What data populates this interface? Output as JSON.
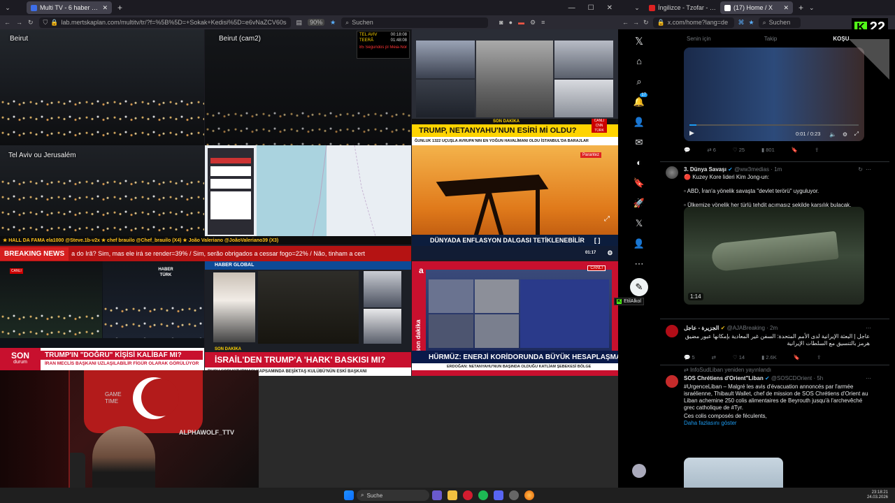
{
  "left_browser": {
    "tab_title": "Multi TV - 6 haber kanalını aynı anda",
    "url": "lab.mertskaplan.com/multitv/tr/?f=%5B%5D=+Sokak+Kedisi%5D=e6vNaZCV60s8tcn%5D=+CNN+Türk%5D=6N8_r2uwLEc",
    "zoom": "90%",
    "search_placeholder": "Suchen"
  },
  "tiles": {
    "beirut": "Beirut",
    "beirut_cam2": "Beirut (cam2)",
    "telaviv": "Tel Aviv ou Jerusalém",
    "timers": {
      "row1_label": "TEL AVIV",
      "row1_time": "00:18:08",
      "row2_label": "TEERÃ",
      "row2_time": "01:48:08",
      "red_text": "85 Segundos pl Meia-Noite"
    },
    "cnn_ticker": "SON DAKİKA",
    "cnn_headline": "TRUMP, NETANYAHU'NUN ESİRİ Mİ OLDU?",
    "cnn_crawl": "ĞUNLUK 1322 UÇUŞLA AVRUPA'NIN EN YOĞUN HAVALİMANI OLDU   İSTANBUL'DA BARAJLAR",
    "cnn_logo": "CNN TÜRK",
    "cnn_live": "CANLI",
    "oil_headline": "DÜNYADA ENFLASYON DALGASI TETİKLENEBİLİR",
    "oil_time": "01:17",
    "oil_logo": "Parantez",
    "ticker_bar": "★ HALL DA FAMA   ela1000 @Steve.1b-v2x   ★ chef brauilo @Chef_brauilo (X4)   ★ João Valeriano @JoãoValeriano39 (X3)",
    "breaking_label": "BREAKING NEWS",
    "breaking_text": "a do Irã? Sim, mas ele irá se render=39% / Sim, serão obrigados a cessar fogo=22% / Não, tinham a cert",
    "haberturk_son": "SON",
    "haberturk_durum": "durum",
    "haberturk_headline": "TRUMP'IN \"DOĞRU\" KİŞİSİ KALİBAF MI?",
    "haberturk_sub": "İRAN MECLİS BAŞKANI UZLAŞILABİLİR FİGÜR OLARAK GÖRÜLÜYOR",
    "haberturk_logo": "HABER TÜRK",
    "haberturk_canli": "CANLI",
    "haberglobal_logo": "HABER GLOBAL",
    "haberglobal_son": "SON DAKİKA",
    "haberglobal_headline": "İSRAİL'DEN TRUMP'A 'HARK' BASKISI MI?",
    "haberglobal_crawl": "RUCU SORUŞTURMASI KAPSAMINDA BEŞİKTAŞ KULÜBÜ'NÜN ESKİ BAŞKANI",
    "a_son": "son dakika",
    "a_headline": "HÜRMÜZ: ENERJİ KORİDORUNDA BÜYÜK HESAPLAŞMA",
    "a_crawl": "ERDOĞAN: NETANYAHU'NUN BAŞINDA OLDUĞU KATLİAM ŞEBEKESİ BÖLGE",
    "a_canli": "CANLI"
  },
  "streamer": {
    "overlay": "ALPHAWOLF_TTV",
    "sign": "GAME TIME"
  },
  "right_browser": {
    "tab1": "İngilizce - Tzofar - Kırmızı Alarm",
    "tab2": "(17) Home / X",
    "url": "x.com/home?lang=de",
    "search_placeholder": "Suchen"
  },
  "overlay_badge": {
    "letter": "K",
    "number": "22"
  },
  "x": {
    "tab_foryou": "Senin için",
    "tab_following": "Takip",
    "tab_right": "KOŞU",
    "notif_count": "17",
    "video1_time": "0:01 / 0:23",
    "tweet1_stats": {
      "reply": "",
      "retweet": "6",
      "like": "25",
      "views": "801"
    },
    "tweet2": {
      "name": "3. Dünya Savaşı",
      "handle": "@ww3medias · 1m",
      "line1": "Kuzey Kore lideri Kim Jong-un:",
      "line2": "ABD, İran'a yönelik savaşta \"devlet terörü\" uyguluyor.",
      "line3": "Ülkemize yönelik her türlü tehdit acımasız şekilde karşılık bulacak.",
      "video_time": "1:14"
    },
    "hover_label": "EtilAlkol",
    "tweet3": {
      "name": "الجزيرة - عاجل",
      "handle": "@AJABreaking · 2m",
      "text": "عاجل | البعثة الإيرانية لدى الأمم المتحدة: السفن غير المعادية بإمكانها عبور مضيق هرمز بالتنسيق مع السلطات الإيرانية",
      "replies": "5",
      "retweets": "14",
      "likes": "2.6K",
      "views": ""
    },
    "tweet4": {
      "reposted_by": "InfoSudLiban yeniden yayınlandı",
      "name": "SOS Chrétiens d'Orient\"Liban",
      "handle": "@SOSCDOrient · 5h",
      "text": "#UrgenceLiban – Malgré les avis d'évacuation annoncés par l'armée israélienne, Thibault Wallet, chef de mission de SOS Chrétiens d'Orient au Liban achemine 250 colis alimentaires de Beyrouth jusqu'à l'archevêché grec catholique de #Tyr.",
      "text2": "Ces colis composés de féculents,",
      "more": "Daha fazlasını göster"
    }
  },
  "taskbar": {
    "search": "Suche",
    "time": "23:18:21",
    "date": "24.03.2026"
  }
}
